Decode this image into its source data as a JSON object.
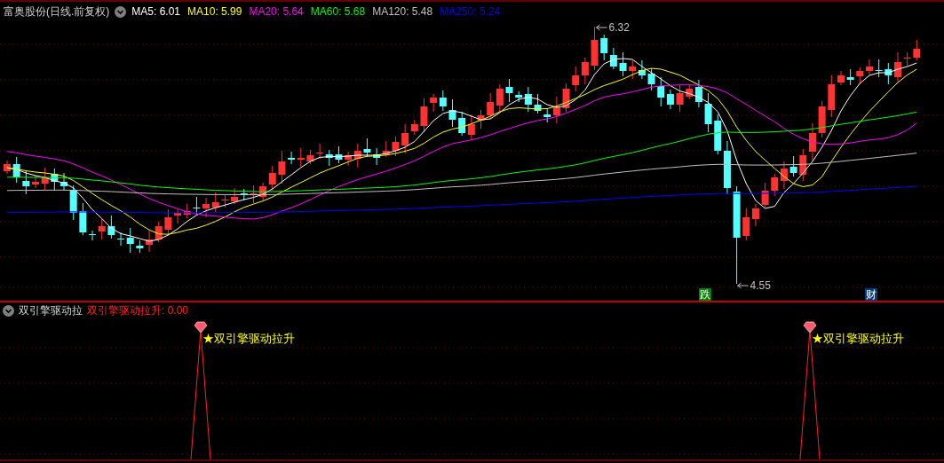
{
  "header": {
    "title": "富奥股份(日线.前复权)",
    "moving_averages": [
      {
        "label": "MA5: 6.01",
        "color": "#ffffff"
      },
      {
        "label": "MA10: 5.99",
        "color": "#ffff00"
      },
      {
        "label": "MA20: 5.64",
        "color": "#ff00ff"
      },
      {
        "label": "MA60: 5.68",
        "color": "#00ff00"
      },
      {
        "label": "MA120: 5.48",
        "color": "#c0c0c0"
      },
      {
        "label": "MA250: 5.24",
        "color": "#0000ff"
      }
    ]
  },
  "price_chart": {
    "high_label": "6.32",
    "low_label": "4.55",
    "badges": [
      {
        "text": "跌",
        "color": "#008000"
      },
      {
        "text": "财",
        "color": "#003c78"
      }
    ]
  },
  "indicator": {
    "title": "双引擎驱动拉",
    "reading": "双引擎驱动拉升: 0.00",
    "signals": [
      {
        "text": "★双引擎驱动拉升"
      },
      {
        "text": "★双引擎驱动拉升"
      }
    ]
  }
}
